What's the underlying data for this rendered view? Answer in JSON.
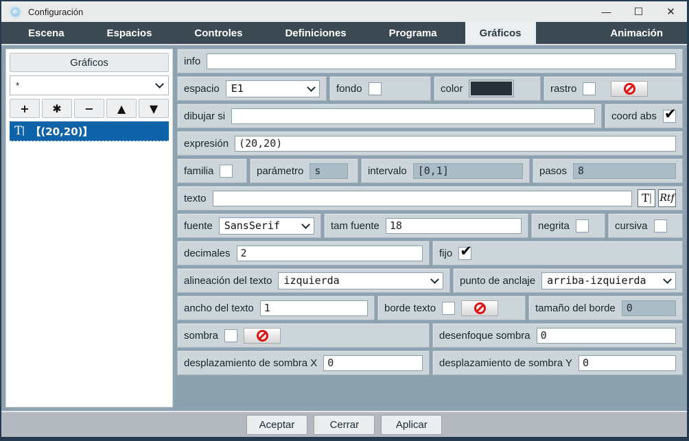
{
  "window": {
    "title": "Configuración",
    "controls": {
      "minimize": "—",
      "maximize": "☐",
      "close": "✕"
    }
  },
  "tabs": [
    {
      "label": "Escena"
    },
    {
      "label": "Espacios"
    },
    {
      "label": "Controles"
    },
    {
      "label": "Definiciones"
    },
    {
      "label": "Programa"
    },
    {
      "label": "Gráficos",
      "active": true
    },
    {
      "label": "Animación"
    }
  ],
  "left_panel": {
    "header": "Gráficos",
    "filter_value": "*",
    "buttons": {
      "add": "+",
      "duplicate": "✱",
      "remove": "−",
      "up": "▲",
      "down": "▼"
    },
    "list": [
      {
        "type": "text-graphic",
        "label": "【(20,20)】",
        "selected": true
      }
    ]
  },
  "form": {
    "info": {
      "label": "info",
      "value": ""
    },
    "espacio": {
      "label": "espacio",
      "value": "E1"
    },
    "fondo": {
      "label": "fondo",
      "checked": false
    },
    "color": {
      "label": "color",
      "value": "#253039"
    },
    "rastro": {
      "label": "rastro",
      "checked": false
    },
    "dibujar_si": {
      "label": "dibujar si",
      "value": ""
    },
    "coord_abs": {
      "label": "coord abs",
      "checked": true
    },
    "expresion": {
      "label": "expresión",
      "value": "(20,20)"
    },
    "familia": {
      "label": "familia",
      "checked": false
    },
    "parametro": {
      "label": "parámetro",
      "value": "s",
      "disabled": true
    },
    "intervalo": {
      "label": "intervalo",
      "value": "[0,1]",
      "disabled": true
    },
    "pasos": {
      "label": "pasos",
      "value": "8",
      "disabled": true
    },
    "texto": {
      "label": "texto",
      "value": "",
      "t_button": "T",
      "rtf_button": "Rtf"
    },
    "fuente": {
      "label": "fuente",
      "value": "SansSerif"
    },
    "tam_fuente": {
      "label": "tam fuente",
      "value": "18"
    },
    "negrita": {
      "label": "negrita",
      "checked": false
    },
    "cursiva": {
      "label": "cursiva",
      "checked": false
    },
    "decimales": {
      "label": "decimales",
      "value": "2"
    },
    "fijo": {
      "label": "fijo",
      "checked": true
    },
    "alineacion": {
      "label": "alineación del texto",
      "value": "izquierda"
    },
    "anclaje": {
      "label": "punto de anclaje",
      "value": "arriba-izquierda"
    },
    "ancho_texto": {
      "label": "ancho del texto",
      "value": "1"
    },
    "borde_texto": {
      "label": "borde texto",
      "checked": false
    },
    "tamano_borde": {
      "label": "tamaño del borde",
      "value": "0",
      "disabled": true
    },
    "sombra": {
      "label": "sombra",
      "checked": false
    },
    "desenfoque": {
      "label": "desenfoque sombra",
      "value": "0"
    },
    "despl_x": {
      "label": "desplazamiento de sombra X",
      "value": "0"
    },
    "despl_y": {
      "label": "desplazamiento de sombra Y",
      "value": "0"
    }
  },
  "footer": {
    "accept": "Aceptar",
    "close": "Cerrar",
    "apply": "Aplicar"
  },
  "colors": {
    "accent_blue": "#0f63a8",
    "tab_bar": "#3b4a52",
    "content_bg": "#8da2ae",
    "box_bg": "#cbd5da",
    "no_sign_red": "#dd1414",
    "color_swatch": "#253039"
  }
}
